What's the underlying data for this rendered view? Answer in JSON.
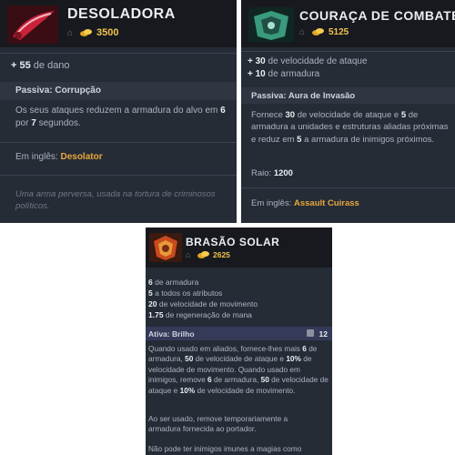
{
  "desolator": {
    "title": "DESOLADORA",
    "cost": "3500",
    "stat_value": "+ 55",
    "stat_label": "de dano",
    "passive_title": "Passiva: Corrupção",
    "passive_text": [
      "Os seus ataques reduzem a armadura do alvo em ",
      "6",
      " por ",
      "7",
      " segundos."
    ],
    "english_label": "Em inglês:",
    "english_name": "Desolator",
    "lore": "Uma arma perversa, usada na tortura de criminosos políticos."
  },
  "assault": {
    "title": "COURAÇA DE COMBATE",
    "cost": "5125",
    "stats": [
      {
        "value": "+ 30",
        "label": "de velocidade de ataque"
      },
      {
        "value": "+ 10",
        "label": "de armadura"
      }
    ],
    "passive_title": "Passiva: Aura de Invasão",
    "passive_text": [
      "Fornece ",
      "30",
      " de velocidade de ataque e ",
      "5",
      " de armadura a unidades e estruturas aliadas próximas e reduz em ",
      "5",
      " a armadura de inimigos próximos."
    ],
    "radius_label": "Raio:",
    "radius_value": "1200",
    "english_label": "Em inglês:",
    "english_name": "Assault Cuirass"
  },
  "shivas": {
    "title": "BRASÃO SOLAR",
    "cost": "2625",
    "stats": [
      {
        "value": "6",
        "label": "de armadura"
      },
      {
        "value": "5",
        "label": "a todos os atributos"
      },
      {
        "value": "20",
        "label": "de velocidade de movimento"
      },
      {
        "value": "1.75",
        "label": "de regeneração de mana"
      }
    ],
    "active_title": "Ativa: Brilho",
    "cooldown": "12",
    "active_text": [
      "Quando usado em aliados, fornece-lhes mais ",
      "6",
      " de armadura, ",
      "50",
      " de velocidade de ataque e ",
      "10%",
      " de velocidade de movimento. Quando usado em inimigos, remove ",
      "6",
      " de armadura, ",
      "50",
      " de velocidade de ataque e ",
      "10%",
      " de velocidade de movimento."
    ],
    "text2": "Ao ser usado, remove temporariamente a armadura fornecida ao portador.",
    "text3": "Não pode ter inimigos imunes a magias como"
  },
  "colors": {
    "panel": "#262c36",
    "header": "#17191e",
    "gold": "#f1c24d",
    "english": "#e7a73a"
  },
  "icons": [
    "house-icon",
    "gold-coins-icon",
    "cooldown-icon"
  ]
}
